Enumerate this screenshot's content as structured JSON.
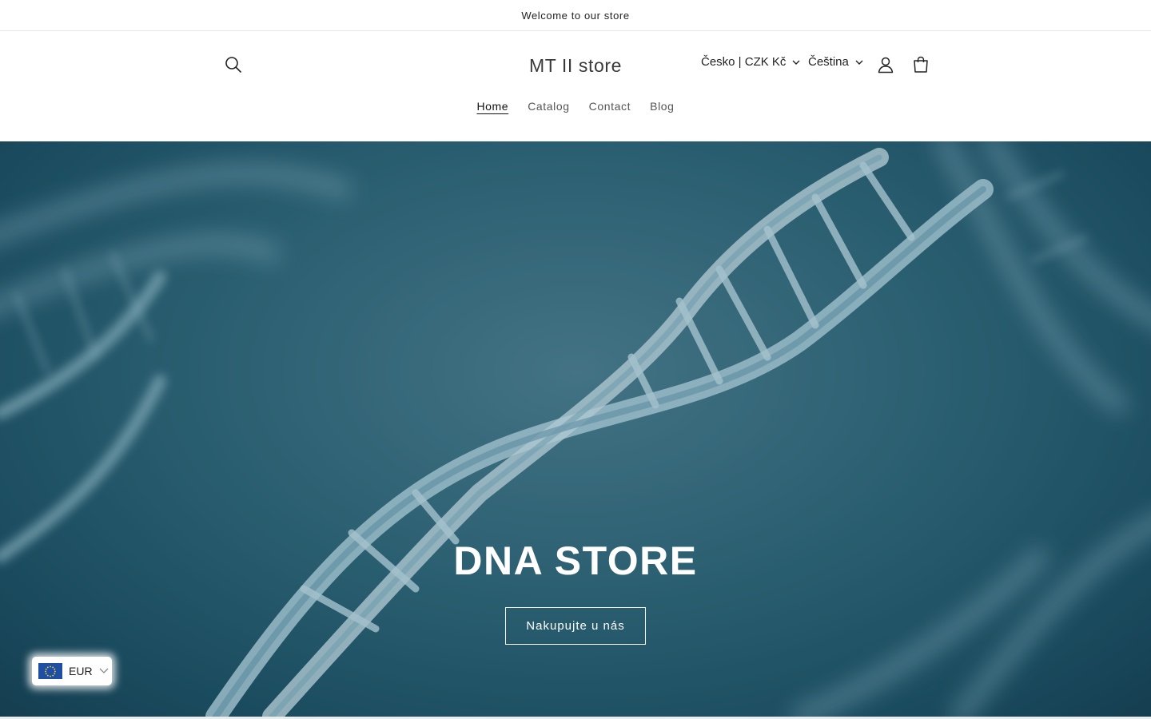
{
  "announcement": {
    "text": "Welcome to our store"
  },
  "header": {
    "logo": "MT II store",
    "country_selector": "Česko | CZK Kč",
    "language_selector": "Čeština",
    "icons": {
      "search": "search-icon",
      "account": "user-icon",
      "cart": "cart-icon"
    }
  },
  "nav": {
    "items": [
      {
        "label": "Home",
        "active": true
      },
      {
        "label": "Catalog",
        "active": false
      },
      {
        "label": "Contact",
        "active": false
      },
      {
        "label": "Blog",
        "active": false
      }
    ]
  },
  "hero": {
    "title": "DNA STORE",
    "button_label": "Nakupujte u nás"
  },
  "currency_widget": {
    "code": "EUR",
    "flag": "eu-flag-icon"
  },
  "colors": {
    "hero_base": "#2f6779",
    "text": "#121212",
    "nav_muted": "#555555",
    "eu_blue": "#1f4fa3"
  }
}
